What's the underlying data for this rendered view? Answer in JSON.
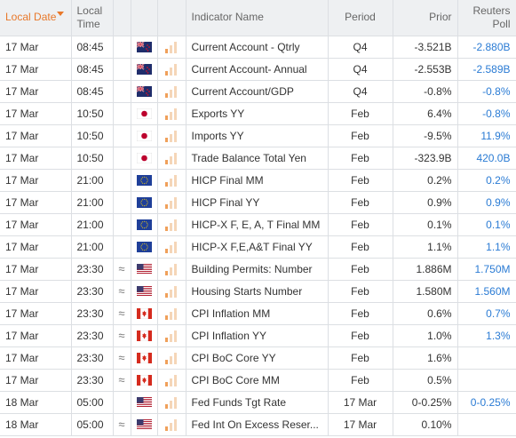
{
  "header": {
    "local_date": "Local Date",
    "local_time": "Local Time",
    "indicator": "Indicator Name",
    "period": "Period",
    "prior": "Prior",
    "poll": "Reuters Poll"
  },
  "colors": {
    "accent": "#e8782a",
    "poll_text": "#2a7bd4",
    "importance": "#f0a05a"
  },
  "rows": [
    {
      "date": "17 Mar",
      "time": "08:45",
      "vol": "",
      "flag": "nz-flag-icon",
      "name": "Current Account - Qtrly",
      "period": "Q4",
      "prior": "-3.521B",
      "poll": "-2.880B"
    },
    {
      "date": "17 Mar",
      "time": "08:45",
      "vol": "",
      "flag": "nz-flag-icon",
      "name": "Current Account- Annual",
      "period": "Q4",
      "prior": "-2.553B",
      "poll": "-2.589B"
    },
    {
      "date": "17 Mar",
      "time": "08:45",
      "vol": "",
      "flag": "nz-flag-icon",
      "name": "Current Account/GDP",
      "period": "Q4",
      "prior": "-0.8%",
      "poll": "-0.8%"
    },
    {
      "date": "17 Mar",
      "time": "10:50",
      "vol": "",
      "flag": "jp-flag-icon",
      "name": "Exports YY",
      "period": "Feb",
      "prior": "6.4%",
      "poll": "-0.8%"
    },
    {
      "date": "17 Mar",
      "time": "10:50",
      "vol": "",
      "flag": "jp-flag-icon",
      "name": "Imports YY",
      "period": "Feb",
      "prior": "-9.5%",
      "poll": "11.9%"
    },
    {
      "date": "17 Mar",
      "time": "10:50",
      "vol": "",
      "flag": "jp-flag-icon",
      "name": "Trade Balance Total Yen",
      "period": "Feb",
      "prior": "-323.9B",
      "poll": "420.0B"
    },
    {
      "date": "17 Mar",
      "time": "21:00",
      "vol": "",
      "flag": "eu-flag-icon",
      "name": "HICP Final MM",
      "period": "Feb",
      "prior": "0.2%",
      "poll": "0.2%"
    },
    {
      "date": "17 Mar",
      "time": "21:00",
      "vol": "",
      "flag": "eu-flag-icon",
      "name": "HICP Final YY",
      "period": "Feb",
      "prior": "0.9%",
      "poll": "0.9%"
    },
    {
      "date": "17 Mar",
      "time": "21:00",
      "vol": "",
      "flag": "eu-flag-icon",
      "name": "HICP-X F, E, A, T Final MM",
      "period": "Feb",
      "prior": "0.1%",
      "poll": "0.1%"
    },
    {
      "date": "17 Mar",
      "time": "21:00",
      "vol": "",
      "flag": "eu-flag-icon",
      "name": "HICP-X F,E,A&T Final YY",
      "period": "Feb",
      "prior": "1.1%",
      "poll": "1.1%"
    },
    {
      "date": "17 Mar",
      "time": "23:30",
      "vol": "≈",
      "flag": "us-flag-icon",
      "name": "Building Permits: Number",
      "period": "Feb",
      "prior": "1.886M",
      "poll": "1.750M"
    },
    {
      "date": "17 Mar",
      "time": "23:30",
      "vol": "≈",
      "flag": "us-flag-icon",
      "name": "Housing Starts Number",
      "period": "Feb",
      "prior": "1.580M",
      "poll": "1.560M"
    },
    {
      "date": "17 Mar",
      "time": "23:30",
      "vol": "≈",
      "flag": "ca-flag-icon",
      "name": "CPI Inflation MM",
      "period": "Feb",
      "prior": "0.6%",
      "poll": "0.7%"
    },
    {
      "date": "17 Mar",
      "time": "23:30",
      "vol": "≈",
      "flag": "ca-flag-icon",
      "name": "CPI Inflation YY",
      "period": "Feb",
      "prior": "1.0%",
      "poll": "1.3%"
    },
    {
      "date": "17 Mar",
      "time": "23:30",
      "vol": "≈",
      "flag": "ca-flag-icon",
      "name": "CPI BoC Core YY",
      "period": "Feb",
      "prior": "1.6%",
      "poll": ""
    },
    {
      "date": "17 Mar",
      "time": "23:30",
      "vol": "≈",
      "flag": "ca-flag-icon",
      "name": "CPI BoC Core MM",
      "period": "Feb",
      "prior": "0.5%",
      "poll": ""
    },
    {
      "date": "18 Mar",
      "time": "05:00",
      "vol": "",
      "flag": "us-flag-icon",
      "name": "Fed Funds Tgt Rate",
      "period": "17 Mar",
      "prior": "0-0.25%",
      "poll": "0-0.25%"
    },
    {
      "date": "18 Mar",
      "time": "05:00",
      "vol": "≈",
      "flag": "us-flag-icon",
      "name": "Fed Int On Excess Reser...",
      "period": "17 Mar",
      "prior": "0.10%",
      "poll": ""
    }
  ]
}
